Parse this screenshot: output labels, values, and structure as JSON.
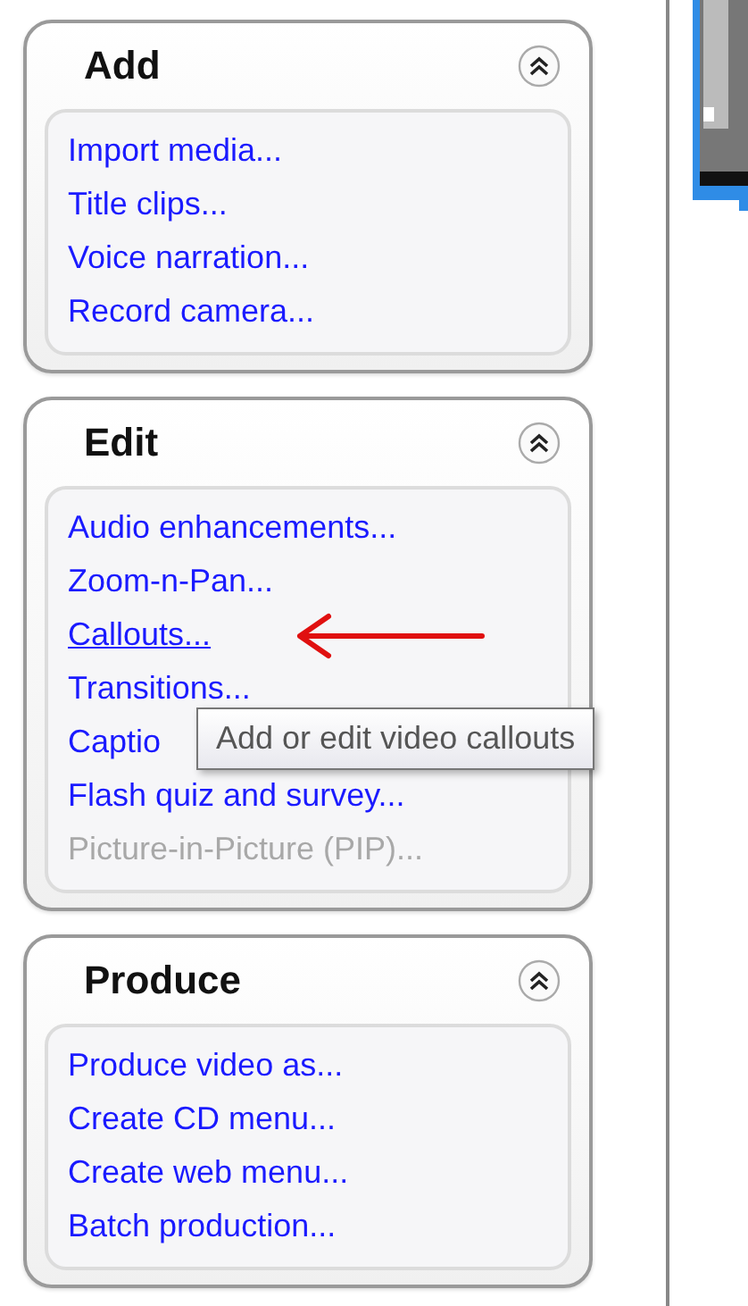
{
  "panels": [
    {
      "title": "Add",
      "items": [
        {
          "label": "Import media...",
          "hovered": false,
          "disabled": false
        },
        {
          "label": "Title clips...",
          "hovered": false,
          "disabled": false
        },
        {
          "label": "Voice narration...",
          "hovered": false,
          "disabled": false
        },
        {
          "label": "Record camera...",
          "hovered": false,
          "disabled": false
        }
      ]
    },
    {
      "title": "Edit",
      "items": [
        {
          "label": "Audio enhancements...",
          "hovered": false,
          "disabled": false
        },
        {
          "label": "Zoom-n-Pan...",
          "hovered": false,
          "disabled": false
        },
        {
          "label": "Callouts...",
          "hovered": true,
          "disabled": false
        },
        {
          "label": "Transitions...",
          "hovered": false,
          "disabled": false
        },
        {
          "label": "Captio",
          "hovered": false,
          "disabled": false
        },
        {
          "label": "Flash quiz and survey...",
          "hovered": false,
          "disabled": false
        },
        {
          "label": "Picture-in-Picture (PIP)...",
          "hovered": false,
          "disabled": true
        }
      ]
    },
    {
      "title": "Produce",
      "items": [
        {
          "label": "Produce video as...",
          "hovered": false,
          "disabled": false
        },
        {
          "label": "Create CD menu...",
          "hovered": false,
          "disabled": false
        },
        {
          "label": "Create web menu...",
          "hovered": false,
          "disabled": false
        },
        {
          "label": "Batch production...",
          "hovered": false,
          "disabled": false
        }
      ]
    }
  ],
  "tooltip": {
    "text": "Add or edit video callouts"
  }
}
